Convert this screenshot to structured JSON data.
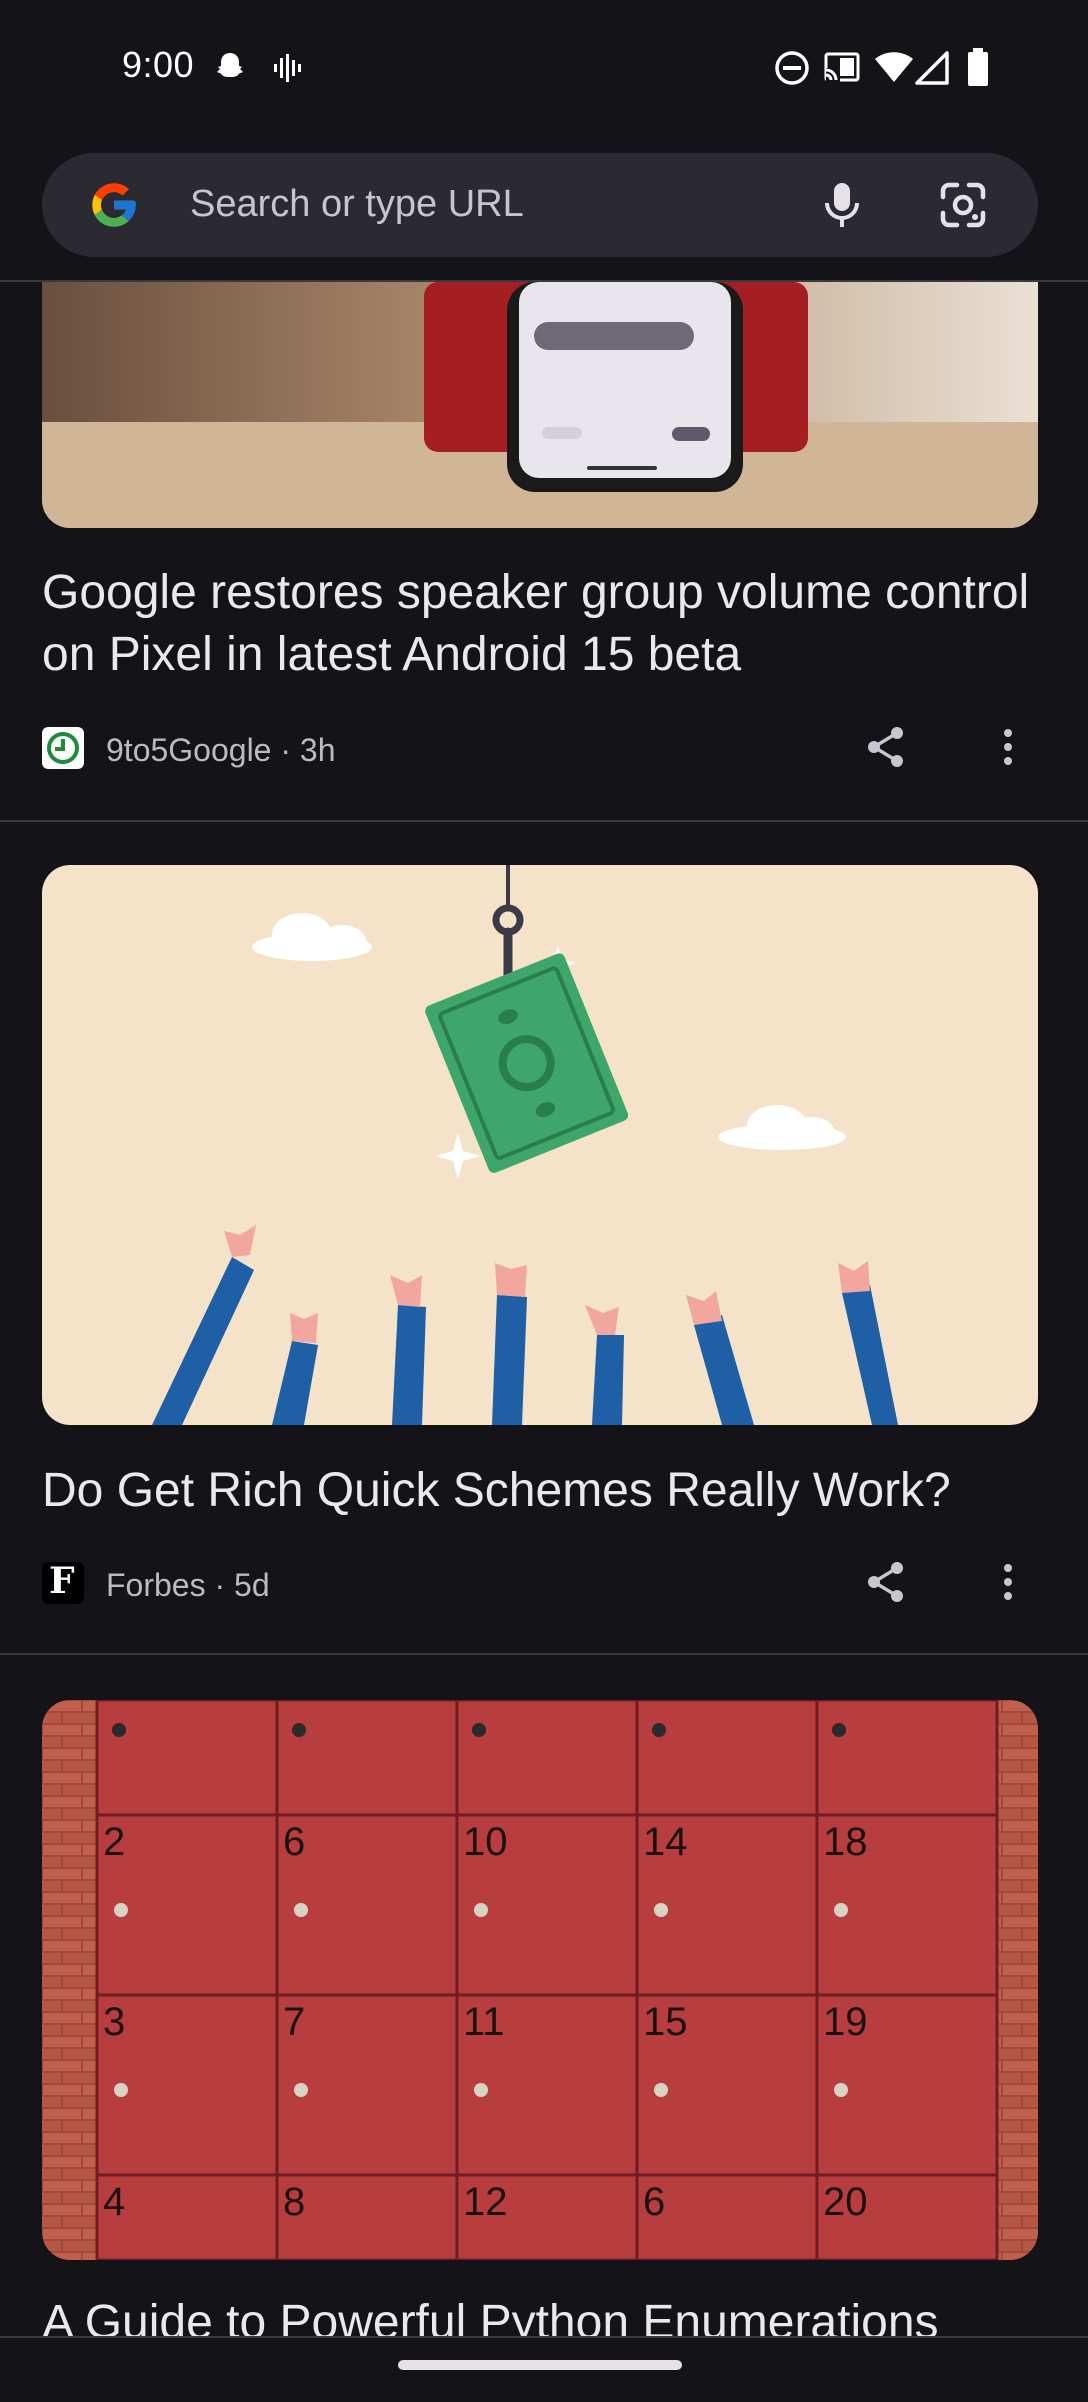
{
  "status_bar": {
    "time": "9:00"
  },
  "search": {
    "placeholder": "Search or type URL"
  },
  "articles": [
    {
      "title": "Google restores speaker group volume control on Pixel in latest Android 15 beta",
      "source": "9to5Google",
      "age": "3h",
      "meta": "9to5Google · 3h"
    },
    {
      "title": "Do Get Rich Quick Schemes Really Work?",
      "source": "Forbes",
      "age": "5d",
      "meta": "Forbes · 5d"
    },
    {
      "title": "A Guide to Powerful Python Enumerations"
    }
  ],
  "locker_numbers": [
    "2",
    "6",
    "10",
    "14",
    "18",
    "3",
    "7",
    "11",
    "15",
    "19",
    "4",
    "8",
    "12",
    "6",
    "20"
  ],
  "icons": {
    "share": "share-icon",
    "more": "more-vert-icon",
    "mic": "mic-icon",
    "lens": "google-lens-icon"
  },
  "colors": {
    "background": "#141318",
    "search_bar": "#2b2a33",
    "banknote": "#3fa66b",
    "locker": "#b73d3e"
  }
}
